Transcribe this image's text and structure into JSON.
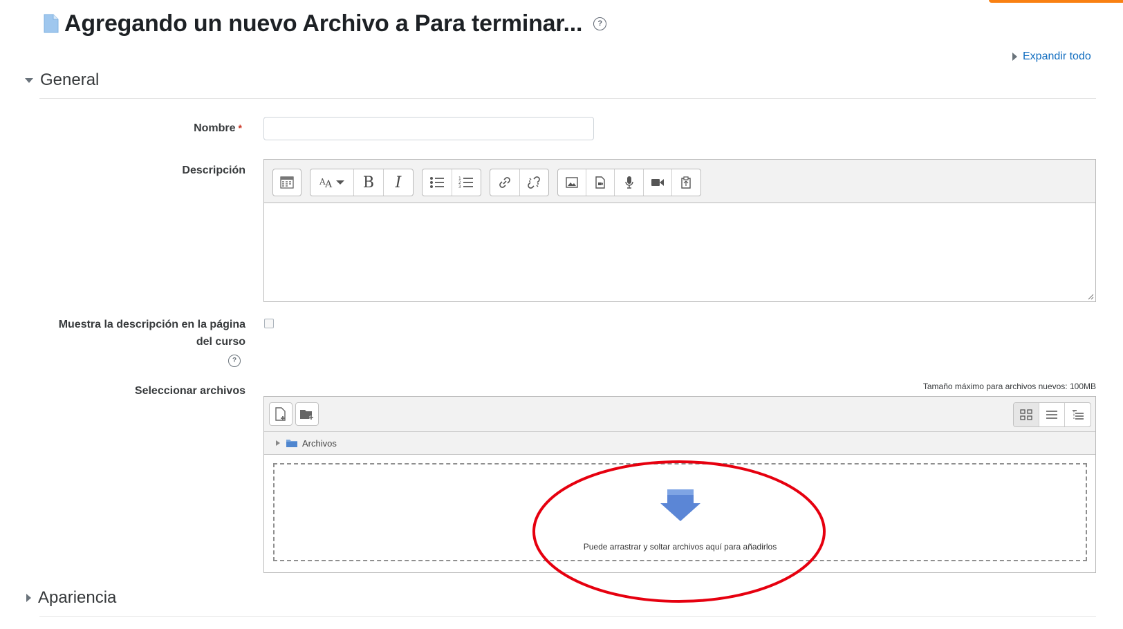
{
  "header": {
    "title": "Agregando un nuevo Archivo a Para terminar...",
    "help_glyph": "?",
    "expand_all": "Expandir todo",
    "icons": {
      "page": "document-icon",
      "help": "help-icon"
    }
  },
  "sections": {
    "general": "General",
    "apariencia": "Apariencia"
  },
  "form": {
    "name_label": "Nombre",
    "required_mark": "*",
    "name_value": "",
    "description_label": "Descripción",
    "show_desc_label_line1": "Muestra la descripción en la página",
    "show_desc_label_line2": "del curso",
    "show_desc_checked": false,
    "help_glyph": "?",
    "files_label": "Seleccionar archivos",
    "max_size_text": "Tamaño máximo para archivos nuevos: 100MB"
  },
  "editor": {
    "toolbar_icons": [
      "toggle-toolbar-icon",
      "font-style-icon",
      "bold-icon",
      "italic-icon",
      "bullet-list-icon",
      "numbered-list-icon",
      "link-icon",
      "unlink-icon",
      "image-icon",
      "media-icon",
      "record-audio-icon",
      "record-video-icon",
      "manage-files-icon"
    ],
    "bold_glyph": "B",
    "italic_glyph": "I",
    "content": ""
  },
  "filemanager": {
    "path_folder": "Archivos",
    "drop_text": "Puede arrastrar y soltar archivos aquí para añadirlos",
    "view_modes": [
      "icons-view",
      "list-view",
      "tree-view"
    ],
    "active_view": "icons-view"
  },
  "colors": {
    "link": "#0f6cbf",
    "required": "#ca3120",
    "annotation_ellipse": "#e6000f",
    "accent": "#f98012",
    "drop_arrow": "#5b86d6"
  }
}
